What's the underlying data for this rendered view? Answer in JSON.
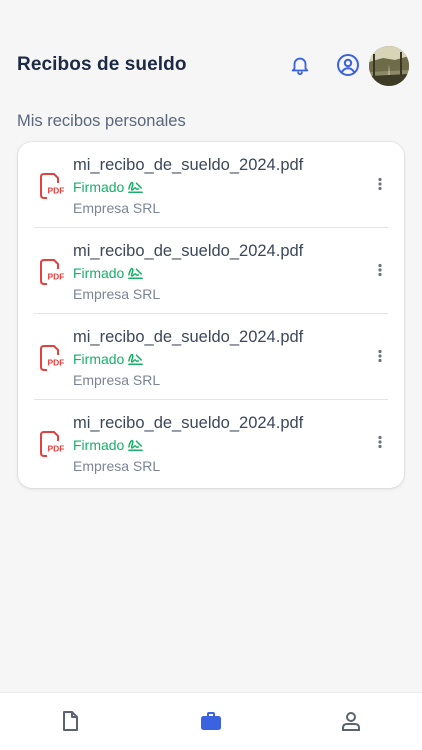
{
  "header": {
    "title": "Recibos de sueldo",
    "icons": [
      "bell-icon",
      "user-circle-icon"
    ],
    "avatar": "avatar"
  },
  "section": {
    "title": "Mis recibos personales"
  },
  "receipts": [
    {
      "filename": "mi_recibo_de_sueldo_2024.pdf",
      "status": "Firmado",
      "company": "Empresa SRL"
    },
    {
      "filename": "mi_recibo_de_sueldo_2024.pdf",
      "status": "Firmado",
      "company": "Empresa SRL"
    },
    {
      "filename": "mi_recibo_de_sueldo_2024.pdf",
      "status": "Firmado",
      "company": "Empresa SRL"
    },
    {
      "filename": "mi_recibo_de_sueldo_2024.pdf",
      "status": "Firmado",
      "company": "Empresa SRL"
    }
  ],
  "pdf_badge": "PDF",
  "bottom_nav": {
    "items": [
      "document-icon",
      "briefcase-icon",
      "person-icon"
    ],
    "active": "briefcase-icon"
  },
  "colors": {
    "title": "#1c2a44",
    "accent": "#3b63e0",
    "signed": "#18b068",
    "pdf_red": "#e2413f",
    "background": "#f6f6f7"
  }
}
